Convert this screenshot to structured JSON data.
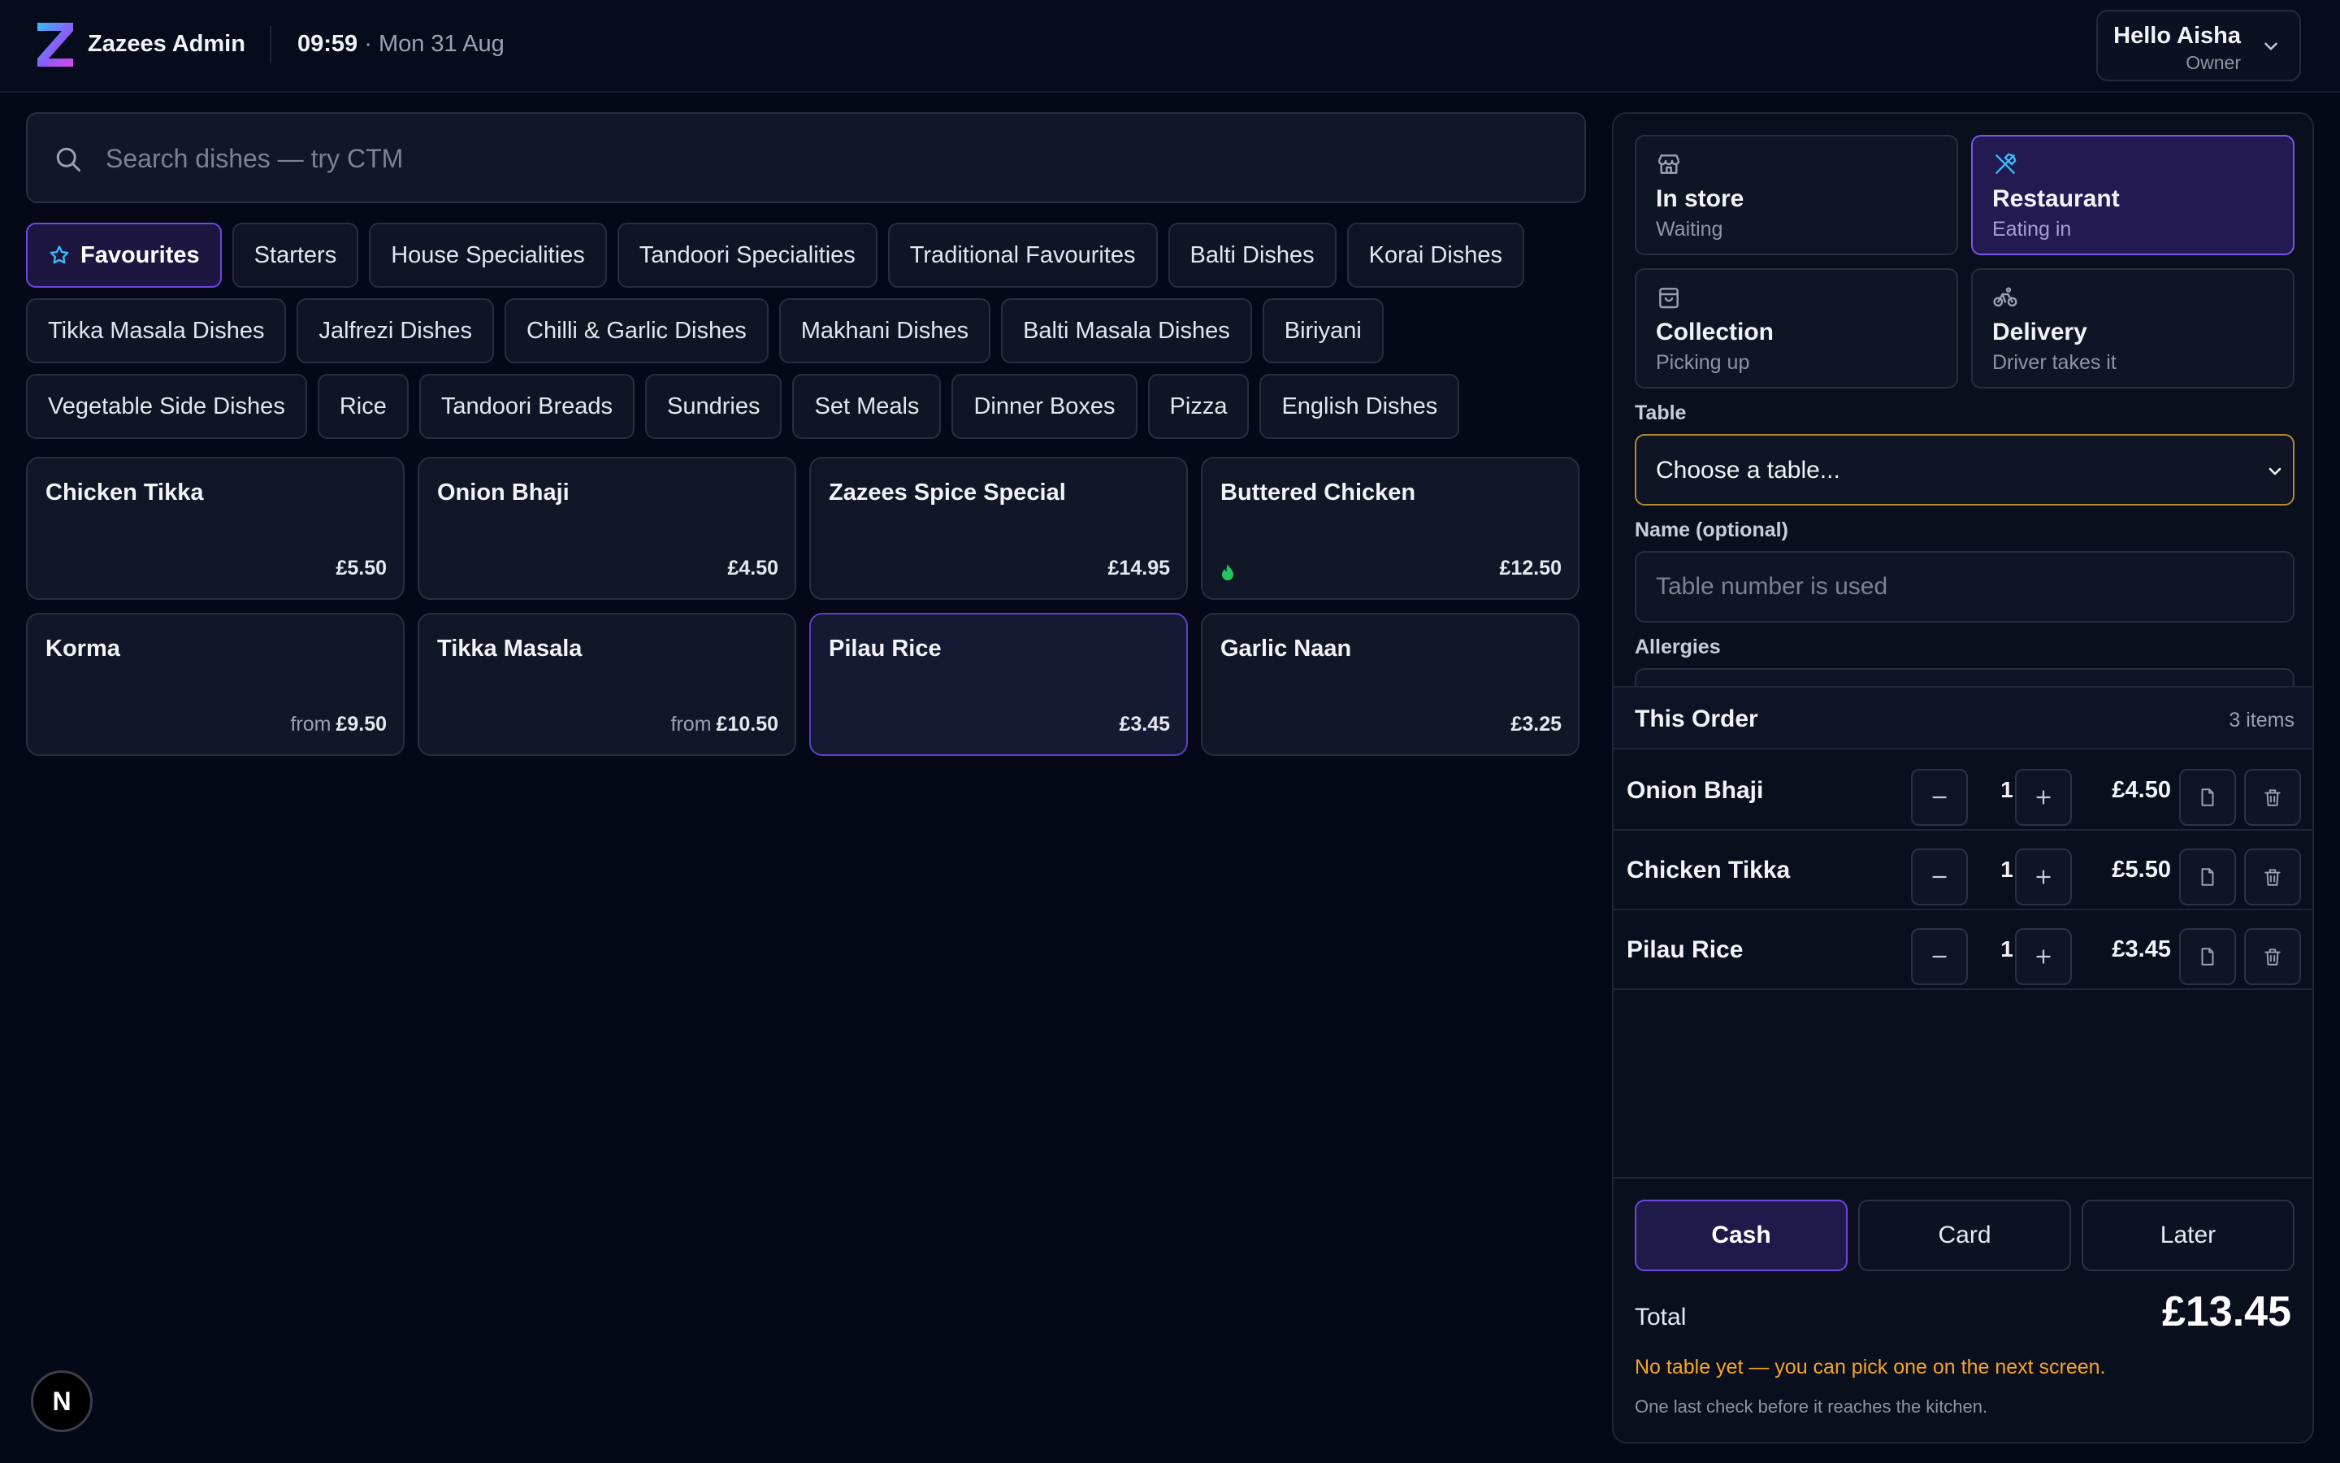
{
  "header": {
    "brand": "Zazees Admin",
    "time": "09:59",
    "date": " · Mon 31 Aug",
    "user_name": "Hello Aisha",
    "user_role": "Owner"
  },
  "search": {
    "placeholder": "Search dishes — try CTM"
  },
  "categories": [
    "Favourites",
    "Starters",
    "House Specialities",
    "Tandoori Specialities",
    "Traditional Favourites",
    "Balti Dishes",
    "Korai Dishes",
    "Tikka Masala Dishes",
    "Jalfrezi Dishes",
    "Chilli & Garlic Dishes",
    "Makhani Dishes",
    "Balti Masala Dishes",
    "Biriyani",
    "Vegetable Side Dishes",
    "Rice",
    "Tandoori Breads",
    "Sundries",
    "Set Meals",
    "Dinner Boxes",
    "Pizza",
    "English Dishes"
  ],
  "active_category": "Favourites",
  "dishes": [
    {
      "name": "Chicken Tikka",
      "prefix": "",
      "price": "£5.50"
    },
    {
      "name": "Onion Bhaji",
      "prefix": "",
      "price": "£4.50"
    },
    {
      "name": "Zazees Spice Special",
      "prefix": "",
      "price": "£14.95"
    },
    {
      "name": "Buttered Chicken",
      "prefix": "",
      "price": "£12.50",
      "icon": "chili-icon"
    },
    {
      "name": "Korma",
      "prefix": "from",
      "price": "£9.50"
    },
    {
      "name": "Tikka Masala",
      "prefix": "from",
      "price": "£10.50"
    },
    {
      "name": "Pilau Rice",
      "prefix": "",
      "price": "£3.45"
    },
    {
      "name": "Garlic Naan",
      "prefix": "",
      "price": "£3.25"
    }
  ],
  "badge": "N",
  "order_types": [
    {
      "title": "In store",
      "sub": "Waiting",
      "icon": "store-icon"
    },
    {
      "title": "Restaurant",
      "sub": "Eating in",
      "icon": "cutlery-icon"
    },
    {
      "title": "Collection",
      "sub": "Picking up",
      "icon": "bag-icon"
    },
    {
      "title": "Delivery",
      "sub": "Driver takes it",
      "icon": "bike-icon"
    }
  ],
  "form": {
    "table_label": "Table",
    "table_value": "Choose a table...",
    "name_label": "Name (optional)",
    "name_placeholder": "Table number is used",
    "allergies_label": "Allergies"
  },
  "order": {
    "title": "This Order",
    "count": "3 items",
    "lines": [
      {
        "name": "Onion Bhaji",
        "qty": "1",
        "price": "£4.50"
      },
      {
        "name": "Chicken Tikka",
        "qty": "1",
        "price": "£5.50"
      },
      {
        "name": "Pilau Rice",
        "qty": "1",
        "price": "£3.45"
      }
    ]
  },
  "payment": {
    "options": [
      "Cash",
      "Card",
      "Later"
    ],
    "selected": "Cash"
  },
  "totals": {
    "label": "Total",
    "value": "£13.45",
    "warning": "No table yet — you can pick one on the next screen.",
    "note": "One last check before it reaches the kitchen."
  },
  "colors": {
    "accent": "#6f47e0",
    "warning": "#f5a524",
    "icon_accent": "#38bdf8"
  }
}
